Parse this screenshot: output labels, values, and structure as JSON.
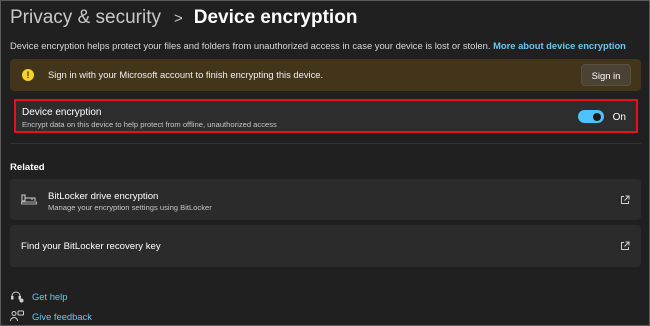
{
  "breadcrumb": {
    "parent": "Privacy & security",
    "separator": ">",
    "current": "Device encryption"
  },
  "description": {
    "text": "Device encryption helps protect your files and folders from unauthorized access in case your device is lost or stolen. ",
    "link": "More about device encryption"
  },
  "banner": {
    "icon": "warning-icon",
    "icon_glyph": "!",
    "text": "Sign in with your Microsoft account to finish encrypting this device.",
    "button": "Sign in"
  },
  "device_encryption": {
    "title": "Device encryption",
    "subtitle": "Encrypt data on this device to help protect from offline, unauthorized access",
    "toggle_on": true,
    "state_label": "On"
  },
  "related": {
    "heading": "Related",
    "items": [
      {
        "icon": "bitlocker-key-icon",
        "title": "BitLocker drive encryption",
        "subtitle": "Manage your encryption settings using BitLocker",
        "trailing_icon": "open-external-icon"
      },
      {
        "title": "Find your BitLocker recovery key",
        "trailing_icon": "open-external-icon"
      }
    ]
  },
  "help_links": [
    {
      "icon": "get-help-icon",
      "label": "Get help"
    },
    {
      "icon": "give-feedback-icon",
      "label": "Give feedback"
    }
  ],
  "colors": {
    "background": "#202020",
    "accent": "#4cc2ff",
    "link": "#6cc5f0",
    "warning_banner": "#433519",
    "highlight_border": "#e8111a"
  }
}
